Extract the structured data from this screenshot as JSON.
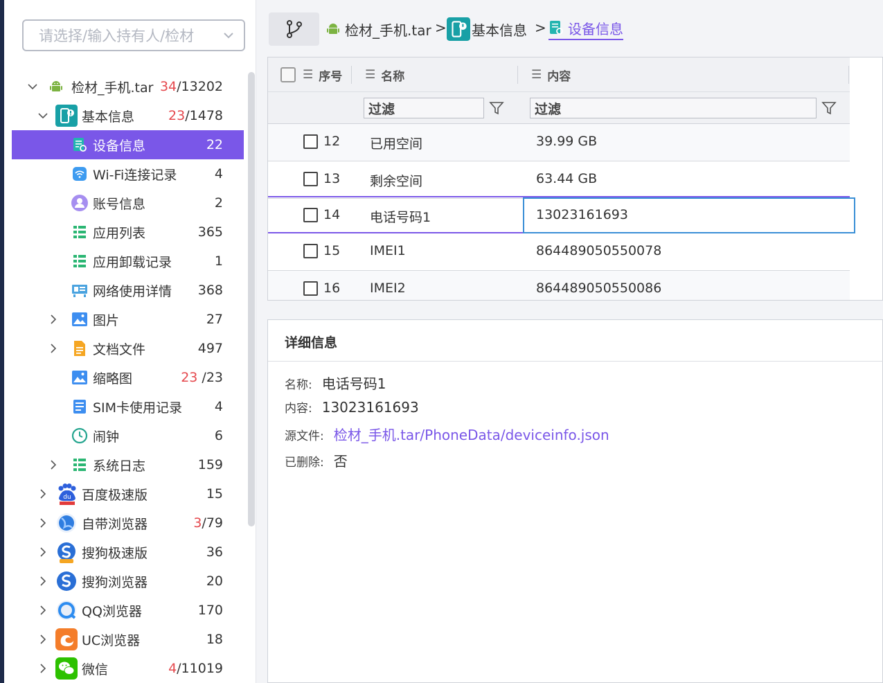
{
  "owner_select": {
    "placeholder": "请选择/输入持有人/检材"
  },
  "tree": [
    {
      "label": "检材_手机.tar",
      "count_red": "34",
      "count_rest": "/13202",
      "icon": "android-icon"
    },
    {
      "label": "基本信息",
      "count_red": "23",
      "count_rest": "/1478",
      "icon": "info-icon"
    },
    {
      "label": "设备信息",
      "count_red": "",
      "count_rest": "22",
      "icon": "device-info-icon"
    },
    {
      "label": "Wi-Fi连接记录",
      "count_red": "",
      "count_rest": "4",
      "icon": "wifi-icon"
    },
    {
      "label": "账号信息",
      "count_red": "",
      "count_rest": "2",
      "icon": "account-icon"
    },
    {
      "label": "应用列表",
      "count_red": "",
      "count_rest": "365",
      "icon": "list-icon"
    },
    {
      "label": "应用卸载记录",
      "count_red": "",
      "count_rest": "1",
      "icon": "list-icon"
    },
    {
      "label": "网络使用详情",
      "count_red": "",
      "count_rest": "368",
      "icon": "network-icon"
    },
    {
      "label": "图片",
      "count_red": "",
      "count_rest": "27",
      "icon": "image-icon"
    },
    {
      "label": "文档文件",
      "count_red": "",
      "count_rest": "497",
      "icon": "document-icon"
    },
    {
      "label": "缩略图",
      "count_red": "23",
      "count_rest": " /23",
      "icon": "image-icon"
    },
    {
      "label": "SIM卡使用记录",
      "count_red": "",
      "count_rest": "4",
      "icon": "sim-icon"
    },
    {
      "label": "闹钟",
      "count_red": "",
      "count_rest": "6",
      "icon": "clock-icon"
    },
    {
      "label": "系统日志",
      "count_red": "",
      "count_rest": "159",
      "icon": "list-icon"
    },
    {
      "label": "百度极速版",
      "count_red": "",
      "count_rest": "15",
      "icon": "baidu-icon"
    },
    {
      "label": "自带浏览器",
      "count_red": "3",
      "count_rest": "/79",
      "icon": "browser-icon"
    },
    {
      "label": "搜狗极速版",
      "count_red": "",
      "count_rest": "36",
      "icon": "sogou-icon"
    },
    {
      "label": "搜狗浏览器",
      "count_red": "",
      "count_rest": "20",
      "icon": "sogou-icon"
    },
    {
      "label": "QQ浏览器",
      "count_red": "",
      "count_rest": "170",
      "icon": "qq-browser-icon"
    },
    {
      "label": "UC浏览器",
      "count_red": "",
      "count_rest": "18",
      "icon": "uc-icon"
    },
    {
      "label": "微信",
      "count_red": "4",
      "count_rest": "/11019",
      "icon": "wechat-icon"
    }
  ],
  "breadcrumb": [
    "检材_手机.tar",
    "基本信息",
    "设备信息"
  ],
  "breadcrumb_sep": ">",
  "grid": {
    "headers": {
      "index": "序号",
      "name": "名称",
      "content": "内容"
    },
    "filter_placeholder": "过滤",
    "rows": [
      {
        "index": "12",
        "name": "已用空间",
        "value": "39.99 GB"
      },
      {
        "index": "13",
        "name": "剩余空间",
        "value": "63.44 GB"
      },
      {
        "index": "14",
        "name": "电话号码1",
        "value": "13023161693"
      },
      {
        "index": "15",
        "name": "IMEI1",
        "value": "864489050550078"
      },
      {
        "index": "16",
        "name": "IMEI2",
        "value": "864489050550086"
      }
    ]
  },
  "detail": {
    "title": "详细信息",
    "name_label": "名称:",
    "name_value": "电话号码1",
    "content_label": "内容:",
    "content_value": "13023161693",
    "source_label": "源文件:",
    "source_value": "检材_手机.tar/PhoneData/deviceinfo.json",
    "deleted_label": "已删除:",
    "deleted_value": "否"
  },
  "colors": {
    "accent": "#7a57e8",
    "focus": "#3a8fd6",
    "count_red": "#e5484d"
  }
}
